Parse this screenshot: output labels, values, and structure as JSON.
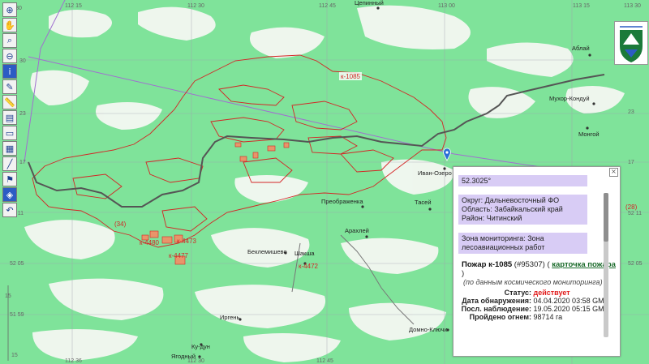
{
  "map": {
    "top_coords": [
      "112 30",
      "112 15",
      "112 30",
      "112 45",
      "113 00",
      "113 15",
      "113 30"
    ],
    "bottom_coords": [
      "112 45",
      "112 36",
      "112 30"
    ],
    "left_coords": [
      "30",
      "23",
      "17",
      "52 11",
      "52 05",
      "15",
      "51 59"
    ],
    "right_coords": [
      "52 11",
      "52 05",
      "52 12",
      "30",
      "23",
      "17"
    ],
    "places": [
      "Цепинный",
      "Аблай",
      "Мухор-Кондуй",
      "Монгой",
      "Иван-Озеро",
      "Тасей",
      "Преображенка",
      "Арахлей",
      "Беклемишево",
      "Шакша",
      "Иргень",
      "Домно-Ключи",
      "Ку-дун",
      "Ягодный"
    ],
    "fires": [
      "к-1085",
      "к-4480",
      "к-4473",
      "к-4477",
      "к-4472",
      "(34)",
      "(28)"
    ],
    "scale": "15"
  },
  "toolbar": {
    "tools": [
      "zoom-in-icon",
      "hand-icon",
      "zoom-area-icon",
      "zoom-out-icon",
      "info-icon",
      "pencil-icon",
      "ruler-icon",
      "layers-icon",
      "eraser-icon",
      "document-icon",
      "line-icon",
      "flag-icon",
      "layers2-icon",
      "undo-icon"
    ]
  },
  "popup": {
    "close": "×",
    "lat": "52.3025°",
    "district": "Округ: Дальневосточный ФО",
    "region": "Область: Забайкальский край",
    "area": "Район: Читинский",
    "zone": "Зона мониторинга: Зона лесоавиационных работ",
    "fire_title": "Пожар к-1085",
    "fire_id": "(#95307)",
    "card_link": "карточка пожара",
    "source_note": "(по данным космического мониторинга)",
    "status_label": "Статус:",
    "status_value": "действует",
    "detect_label": "Дата обнаружения:",
    "detect_value": "04.04.2020 03:58 GMT",
    "last_label": "Посл. наблюдение:",
    "last_value": "19.05.2020 05:15 GMT",
    "burn_label": "Пройдено огнем:",
    "burn_value": "98714 га"
  },
  "colors": {
    "map_bg": "#7fe39a",
    "fire_outline": "#d42525",
    "road": "#555555",
    "border": "#a070d0"
  }
}
